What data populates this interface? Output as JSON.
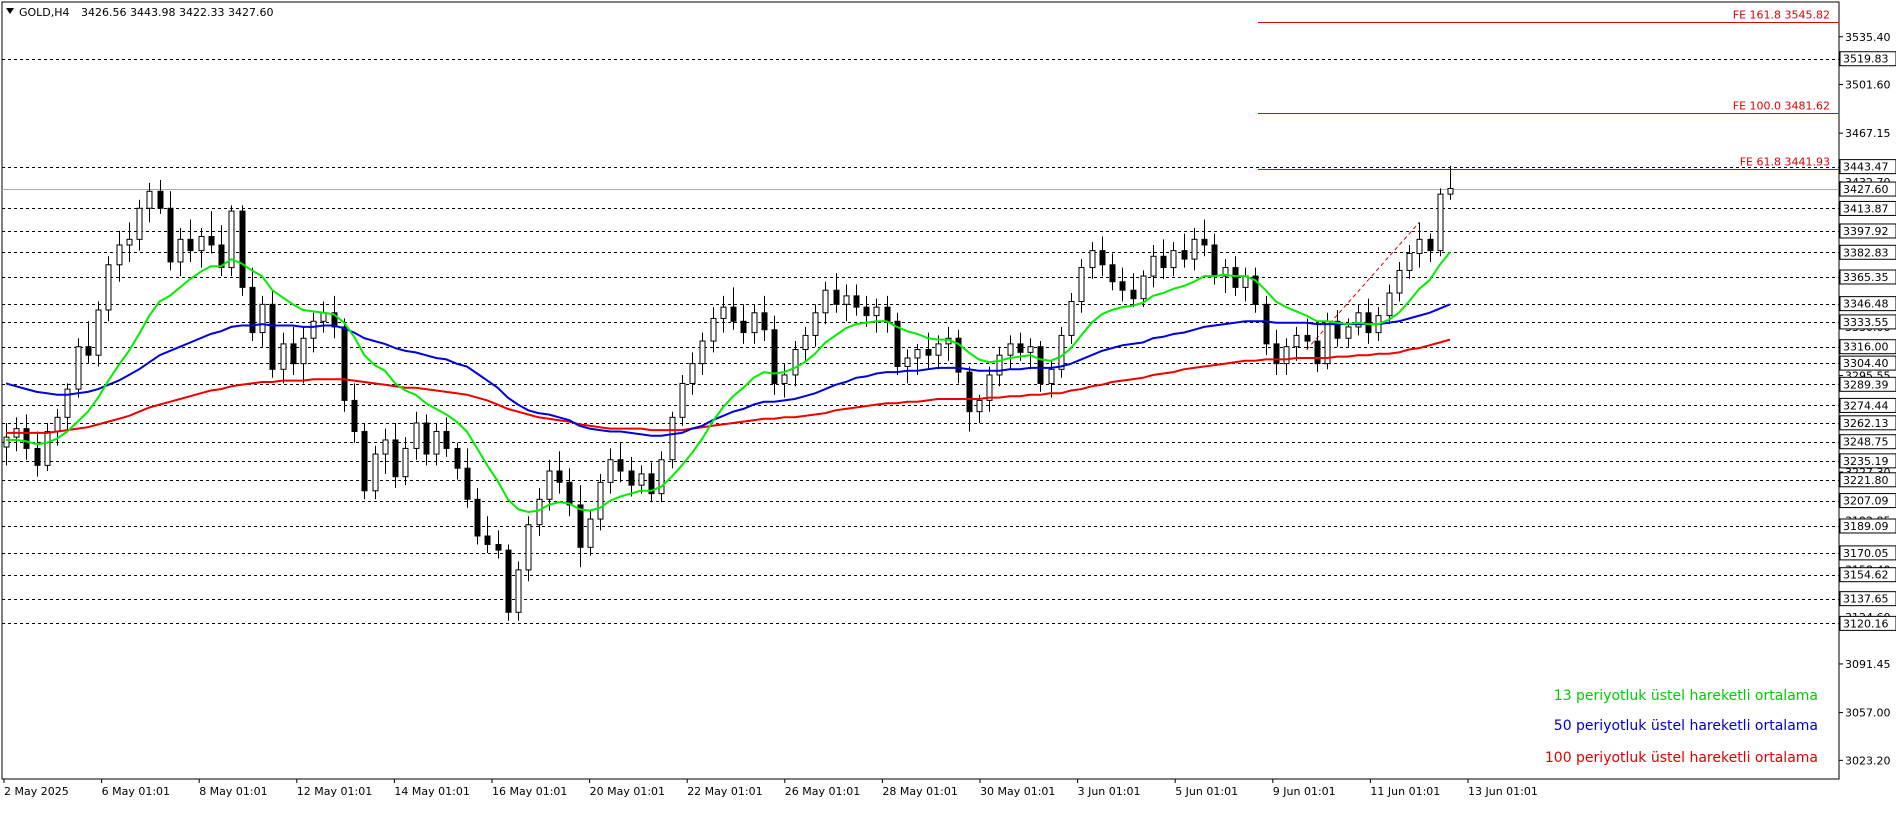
{
  "header": {
    "symbol": "GOLD,H4",
    "ohlc": "3426.56 3443.98 3422.33 3427.60"
  },
  "colors": {
    "ema13": "#00ee00",
    "ema50": "#0000dd",
    "ema100": "#ee0000",
    "fib": "#dd0000",
    "level": "#000000",
    "current": "#aaaaaa"
  },
  "legend": [
    {
      "label": "13 periyotluk üstel hareketli ortalama",
      "color": "#00cc00"
    },
    {
      "label": "50 periyotluk üstel hareketli ortalama",
      "color": "#0000cc"
    },
    {
      "label": "100 periyotluk üstel hareketli ortalama",
      "color": "#dd0000"
    }
  ],
  "chart_data": {
    "type": "candlestick",
    "ylim": [
      3010,
      3560
    ],
    "price_ticks": [
      3535.4,
      3501.6,
      3467.15,
      3432.7,
      3398.25,
      3364.45,
      3330.0,
      3295.55,
      3261.1,
      3227.3,
      3192.85,
      3158.4,
      3124.6,
      3091.45,
      3057.0,
      3023.2
    ],
    "time_labels": [
      "2 May 2025",
      "6 May 01:01",
      "8 May 01:01",
      "12 May 01:01",
      "14 May 01:01",
      "16 May 01:01",
      "20 May 01:01",
      "22 May 01:01",
      "26 May 01:01",
      "28 May 01:01",
      "30 May 01:01",
      "3 Jun 01:01",
      "5 Jun 01:01",
      "9 Jun 01:01",
      "11 Jun 01:01",
      "13 Jun 01:01"
    ],
    "horizontal_levels": [
      3519.83,
      3443.47,
      3413.87,
      3397.92,
      3382.83,
      3365.35,
      3346.48,
      3333.55,
      3316.0,
      3304.4,
      3289.39,
      3274.44,
      3262.13,
      3248.75,
      3235.19,
      3221.8,
      3207.09,
      3189.09,
      3170.05,
      3154.62,
      3137.65,
      3120.16
    ],
    "current_price": 3427.6,
    "fibonacci": [
      {
        "label": "FE 161.8 3545.82",
        "value": 3545.82
      },
      {
        "label": "FE 100.0 3481.62",
        "value": 3481.62
      },
      {
        "label": "FE 61.8 3441.93",
        "value": 3441.93
      }
    ],
    "candles": [
      [
        3245,
        3262,
        3232,
        3252
      ],
      [
        3252,
        3266,
        3242,
        3258
      ],
      [
        3258,
        3268,
        3236,
        3244
      ],
      [
        3244,
        3256,
        3224,
        3232
      ],
      [
        3232,
        3262,
        3228,
        3256
      ],
      [
        3256,
        3272,
        3246,
        3266
      ],
      [
        3266,
        3290,
        3256,
        3286
      ],
      [
        3286,
        3322,
        3280,
        3316
      ],
      [
        3316,
        3334,
        3304,
        3310
      ],
      [
        3310,
        3348,
        3302,
        3342
      ],
      [
        3342,
        3380,
        3334,
        3374
      ],
      [
        3374,
        3398,
        3362,
        3388
      ],
      [
        3388,
        3404,
        3376,
        3392
      ],
      [
        3392,
        3420,
        3384,
        3414
      ],
      [
        3414,
        3432,
        3404,
        3426
      ],
      [
        3426,
        3434,
        3410,
        3414
      ],
      [
        3414,
        3426,
        3370,
        3376
      ],
      [
        3376,
        3400,
        3366,
        3392
      ],
      [
        3392,
        3406,
        3376,
        3384
      ],
      [
        3384,
        3400,
        3372,
        3394
      ],
      [
        3394,
        3412,
        3382,
        3388
      ],
      [
        3388,
        3402,
        3366,
        3372
      ],
      [
        3372,
        3416,
        3366,
        3412
      ],
      [
        3412,
        3416,
        3352,
        3358
      ],
      [
        3358,
        3372,
        3320,
        3326
      ],
      [
        3326,
        3352,
        3316,
        3346
      ],
      [
        3346,
        3356,
        3294,
        3300
      ],
      [
        3300,
        3326,
        3290,
        3318
      ],
      [
        3318,
        3330,
        3296,
        3304
      ],
      [
        3304,
        3330,
        3290,
        3322
      ],
      [
        3322,
        3340,
        3312,
        3334
      ],
      [
        3334,
        3348,
        3326,
        3340
      ],
      [
        3340,
        3352,
        3322,
        3330
      ],
      [
        3330,
        3336,
        3270,
        3278
      ],
      [
        3278,
        3290,
        3248,
        3256
      ],
      [
        3256,
        3262,
        3208,
        3214
      ],
      [
        3214,
        3246,
        3208,
        3240
      ],
      [
        3240,
        3258,
        3226,
        3250
      ],
      [
        3250,
        3262,
        3216,
        3224
      ],
      [
        3224,
        3252,
        3218,
        3244
      ],
      [
        3244,
        3270,
        3236,
        3262
      ],
      [
        3262,
        3268,
        3232,
        3240
      ],
      [
        3240,
        3262,
        3232,
        3256
      ],
      [
        3256,
        3266,
        3238,
        3244
      ],
      [
        3244,
        3248,
        3222,
        3230
      ],
      [
        3230,
        3244,
        3202,
        3208
      ],
      [
        3208,
        3216,
        3176,
        3182
      ],
      [
        3182,
        3196,
        3170,
        3176
      ],
      [
        3176,
        3186,
        3166,
        3172
      ],
      [
        3172,
        3176,
        3122,
        3128
      ],
      [
        3128,
        3164,
        3122,
        3158
      ],
      [
        3158,
        3196,
        3150,
        3190
      ],
      [
        3190,
        3216,
        3182,
        3208
      ],
      [
        3208,
        3236,
        3200,
        3228
      ],
      [
        3228,
        3242,
        3212,
        3220
      ],
      [
        3220,
        3230,
        3196,
        3204
      ],
      [
        3204,
        3218,
        3160,
        3174
      ],
      [
        3174,
        3200,
        3168,
        3194
      ],
      [
        3194,
        3226,
        3186,
        3220
      ],
      [
        3220,
        3244,
        3212,
        3236
      ],
      [
        3236,
        3248,
        3220,
        3228
      ],
      [
        3228,
        3238,
        3210,
        3218
      ],
      [
        3218,
        3232,
        3212,
        3226
      ],
      [
        3226,
        3234,
        3206,
        3212
      ],
      [
        3212,
        3242,
        3206,
        3236
      ],
      [
        3236,
        3270,
        3230,
        3266
      ],
      [
        3266,
        3296,
        3260,
        3290
      ],
      [
        3290,
        3312,
        3282,
        3304
      ],
      [
        3304,
        3326,
        3296,
        3320
      ],
      [
        3320,
        3344,
        3312,
        3336
      ],
      [
        3336,
        3352,
        3326,
        3344
      ],
      [
        3344,
        3358,
        3328,
        3334
      ],
      [
        3334,
        3346,
        3318,
        3326
      ],
      [
        3326,
        3346,
        3318,
        3340
      ],
      [
        3340,
        3352,
        3320,
        3328
      ],
      [
        3328,
        3338,
        3282,
        3290
      ],
      [
        3290,
        3304,
        3280,
        3296
      ],
      [
        3296,
        3320,
        3288,
        3314
      ],
      [
        3314,
        3330,
        3306,
        3324
      ],
      [
        3324,
        3346,
        3316,
        3340
      ],
      [
        3340,
        3362,
        3332,
        3356
      ],
      [
        3356,
        3368,
        3340,
        3346
      ],
      [
        3346,
        3360,
        3334,
        3352
      ],
      [
        3352,
        3360,
        3338,
        3344
      ],
      [
        3344,
        3352,
        3330,
        3338
      ],
      [
        3338,
        3350,
        3326,
        3344
      ],
      [
        3344,
        3352,
        3326,
        3334
      ],
      [
        3334,
        3340,
        3296,
        3302
      ],
      [
        3302,
        3314,
        3290,
        3308
      ],
      [
        3308,
        3318,
        3296,
        3314
      ],
      [
        3314,
        3326,
        3300,
        3310
      ],
      [
        3310,
        3324,
        3300,
        3318
      ],
      [
        3318,
        3330,
        3306,
        3322
      ],
      [
        3322,
        3328,
        3290,
        3298
      ],
      [
        3298,
        3302,
        3256,
        3270
      ],
      [
        3270,
        3282,
        3262,
        3278
      ],
      [
        3278,
        3302,
        3270,
        3296
      ],
      [
        3296,
        3316,
        3288,
        3310
      ],
      [
        3310,
        3324,
        3300,
        3318
      ],
      [
        3318,
        3326,
        3306,
        3312
      ],
      [
        3312,
        3322,
        3300,
        3316
      ],
      [
        3316,
        3320,
        3284,
        3290
      ],
      [
        3290,
        3306,
        3280,
        3300
      ],
      [
        3300,
        3330,
        3294,
        3324
      ],
      [
        3324,
        3354,
        3318,
        3348
      ],
      [
        3348,
        3378,
        3340,
        3372
      ],
      [
        3372,
        3390,
        3364,
        3384
      ],
      [
        3384,
        3394,
        3366,
        3374
      ],
      [
        3374,
        3382,
        3356,
        3362
      ],
      [
        3362,
        3372,
        3348,
        3356
      ],
      [
        3356,
        3368,
        3344,
        3350
      ],
      [
        3350,
        3370,
        3344,
        3366
      ],
      [
        3366,
        3388,
        3358,
        3380
      ],
      [
        3380,
        3392,
        3364,
        3372
      ],
      [
        3372,
        3390,
        3366,
        3384
      ],
      [
        3384,
        3396,
        3372,
        3378
      ],
      [
        3378,
        3400,
        3370,
        3392
      ],
      [
        3392,
        3406,
        3380,
        3388
      ],
      [
        3388,
        3396,
        3360,
        3366
      ],
      [
        3366,
        3378,
        3354,
        3372
      ],
      [
        3372,
        3380,
        3352,
        3358
      ],
      [
        3358,
        3372,
        3348,
        3366
      ],
      [
        3366,
        3372,
        3340,
        3346
      ],
      [
        3346,
        3352,
        3310,
        3318
      ],
      [
        3318,
        3328,
        3296,
        3304
      ],
      [
        3304,
        3322,
        3296,
        3316
      ],
      [
        3316,
        3330,
        3306,
        3324
      ],
      [
        3324,
        3336,
        3314,
        3320
      ],
      [
        3320,
        3332,
        3298,
        3304
      ],
      [
        3304,
        3340,
        3300,
        3334
      ],
      [
        3334,
        3342,
        3316,
        3322
      ],
      [
        3322,
        3336,
        3316,
        3330
      ],
      [
        3330,
        3346,
        3324,
        3340
      ],
      [
        3340,
        3350,
        3318,
        3326
      ],
      [
        3326,
        3344,
        3320,
        3338
      ],
      [
        3338,
        3360,
        3332,
        3354
      ],
      [
        3354,
        3376,
        3348,
        3370
      ],
      [
        3370,
        3388,
        3364,
        3382
      ],
      [
        3382,
        3404,
        3372,
        3392
      ],
      [
        3392,
        3396,
        3376,
        3384
      ],
      [
        3384,
        3428,
        3380,
        3424
      ],
      [
        3424,
        3444,
        3420,
        3428
      ]
    ],
    "ema13": [
      3250,
      3250,
      3249,
      3247,
      3248,
      3251,
      3256,
      3263,
      3270,
      3280,
      3292,
      3303,
      3313,
      3325,
      3338,
      3348,
      3352,
      3358,
      3364,
      3369,
      3373,
      3373,
      3378,
      3375,
      3370,
      3366,
      3356,
      3351,
      3346,
      3342,
      3341,
      3340,
      3339,
      3333,
      3323,
      3310,
      3303,
      3299,
      3290,
      3285,
      3282,
      3276,
      3272,
      3268,
      3263,
      3256,
      3244,
      3232,
      3221,
      3208,
      3201,
      3199,
      3200,
      3204,
      3206,
      3205,
      3201,
      3200,
      3202,
      3207,
      3210,
      3212,
      3214,
      3214,
      3217,
      3224,
      3232,
      3241,
      3251,
      3263,
      3273,
      3281,
      3287,
      3294,
      3298,
      3297,
      3298,
      3301,
      3305,
      3311,
      3319,
      3324,
      3329,
      3332,
      3333,
      3334,
      3334,
      3330,
      3327,
      3325,
      3322,
      3321,
      3321,
      3318,
      3312,
      3307,
      3305,
      3306,
      3308,
      3309,
      3310,
      3307,
      3306,
      3309,
      3315,
      3324,
      3333,
      3339,
      3342,
      3344,
      3345,
      3347,
      3352,
      3354,
      3357,
      3359,
      3362,
      3366,
      3366,
      3367,
      3366,
      3366,
      3363,
      3356,
      3348,
      3344,
      3341,
      3338,
      3334,
      3334,
      3333,
      3332,
      3333,
      3332,
      3332,
      3335,
      3340,
      3348,
      3357,
      3363,
      3374,
      3383
    ],
    "ema50": [
      3290,
      3288,
      3286,
      3284,
      3283,
      3282,
      3282,
      3283,
      3284,
      3286,
      3289,
      3292,
      3296,
      3300,
      3305,
      3310,
      3313,
      3316,
      3319,
      3322,
      3325,
      3327,
      3330,
      3331,
      3331,
      3332,
      3331,
      3331,
      3331,
      3330,
      3330,
      3331,
      3331,
      3329,
      3326,
      3322,
      3320,
      3318,
      3315,
      3313,
      3312,
      3310,
      3308,
      3307,
      3304,
      3302,
      3297,
      3292,
      3287,
      3280,
      3275,
      3271,
      3269,
      3268,
      3266,
      3264,
      3260,
      3258,
      3257,
      3256,
      3256,
      3255,
      3254,
      3253,
      3253,
      3254,
      3255,
      3258,
      3260,
      3264,
      3267,
      3270,
      3272,
      3275,
      3277,
      3277,
      3278,
      3279,
      3281,
      3283,
      3286,
      3289,
      3291,
      3294,
      3295,
      3297,
      3298,
      3298,
      3299,
      3299,
      3300,
      3301,
      3301,
      3301,
      3300,
      3299,
      3299,
      3299,
      3300,
      3300,
      3301,
      3301,
      3301,
      3302,
      3304,
      3307,
      3310,
      3313,
      3315,
      3317,
      3318,
      3319,
      3322,
      3323,
      3325,
      3326,
      3328,
      3330,
      3331,
      3332,
      3333,
      3334,
      3334,
      3334,
      3333,
      3333,
      3333,
      3333,
      3332,
      3332,
      3332,
      3332,
      3332,
      3332,
      3332,
      3333,
      3334,
      3336,
      3338,
      3340,
      3343,
      3346
    ],
    "ema100": [
      3255,
      3255,
      3255,
      3255,
      3255,
      3256,
      3257,
      3258,
      3259,
      3261,
      3263,
      3265,
      3267,
      3270,
      3273,
      3275,
      3277,
      3279,
      3281,
      3283,
      3285,
      3286,
      3288,
      3289,
      3290,
      3291,
      3291,
      3292,
      3292,
      3292,
      3293,
      3293,
      3293,
      3293,
      3292,
      3291,
      3290,
      3289,
      3288,
      3287,
      3287,
      3286,
      3285,
      3284,
      3283,
      3282,
      3280,
      3278,
      3275,
      3272,
      3270,
      3268,
      3266,
      3265,
      3264,
      3263,
      3261,
      3260,
      3259,
      3258,
      3258,
      3258,
      3258,
      3257,
      3257,
      3257,
      3257,
      3258,
      3259,
      3260,
      3261,
      3262,
      3263,
      3264,
      3265,
      3265,
      3266,
      3266,
      3267,
      3268,
      3269,
      3271,
      3272,
      3273,
      3274,
      3275,
      3276,
      3276,
      3277,
      3277,
      3278,
      3279,
      3279,
      3279,
      3279,
      3279,
      3280,
      3280,
      3281,
      3281,
      3282,
      3282,
      3283,
      3283,
      3285,
      3286,
      3288,
      3289,
      3291,
      3292,
      3293,
      3294,
      3296,
      3297,
      3298,
      3300,
      3301,
      3302,
      3303,
      3304,
      3305,
      3306,
      3306,
      3307,
      3307,
      3307,
      3308,
      3308,
      3308,
      3308,
      3309,
      3309,
      3310,
      3310,
      3311,
      3311,
      3312,
      3314,
      3315,
      3317,
      3319,
      3321
    ]
  }
}
